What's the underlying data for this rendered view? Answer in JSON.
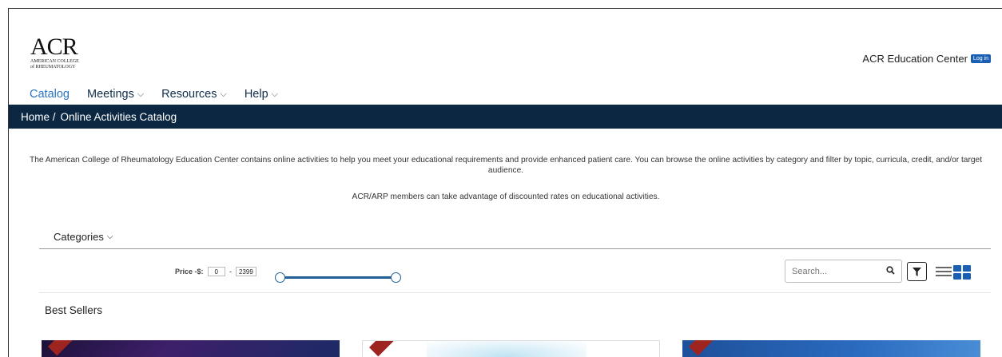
{
  "header": {
    "logo_big": "ACR",
    "logo_line1": "AMERICAN COLLEGE",
    "logo_line2": "of RHEUMATOLOGY",
    "site_title": "ACR Education Center",
    "login_label": "Log in"
  },
  "nav": {
    "items": [
      {
        "label": "Catalog",
        "active": true
      },
      {
        "label": "Meetings"
      },
      {
        "label": "Resources"
      },
      {
        "label": "Help"
      }
    ]
  },
  "breadcrumb": {
    "home": "Home /",
    "current": "Online Activities Catalog"
  },
  "intro": {
    "paragraph": "The American College of Rheumatology Education Center contains online activities to help you meet your educational requirements and provide enhanced patient care. You can browse the online activities by category and filter by topic, curricula, credit, and/or target audience.",
    "members_note": "ACR/ARP members can take advantage of discounted rates on educational activities."
  },
  "filters": {
    "categories_label": "Categories",
    "price_label": "Price -$:",
    "price_min": "0",
    "price_sep": "-",
    "price_max": "2399",
    "search_placeholder": "Search..."
  },
  "section": {
    "best_sellers": "Best Sellers"
  },
  "colors": {
    "nav_active": "#2a73c2",
    "breadcrumb_bg": "#0b2742",
    "accent": "#1a5fb4",
    "slider": "#1f5f96",
    "ribbon": "#9e2420"
  }
}
